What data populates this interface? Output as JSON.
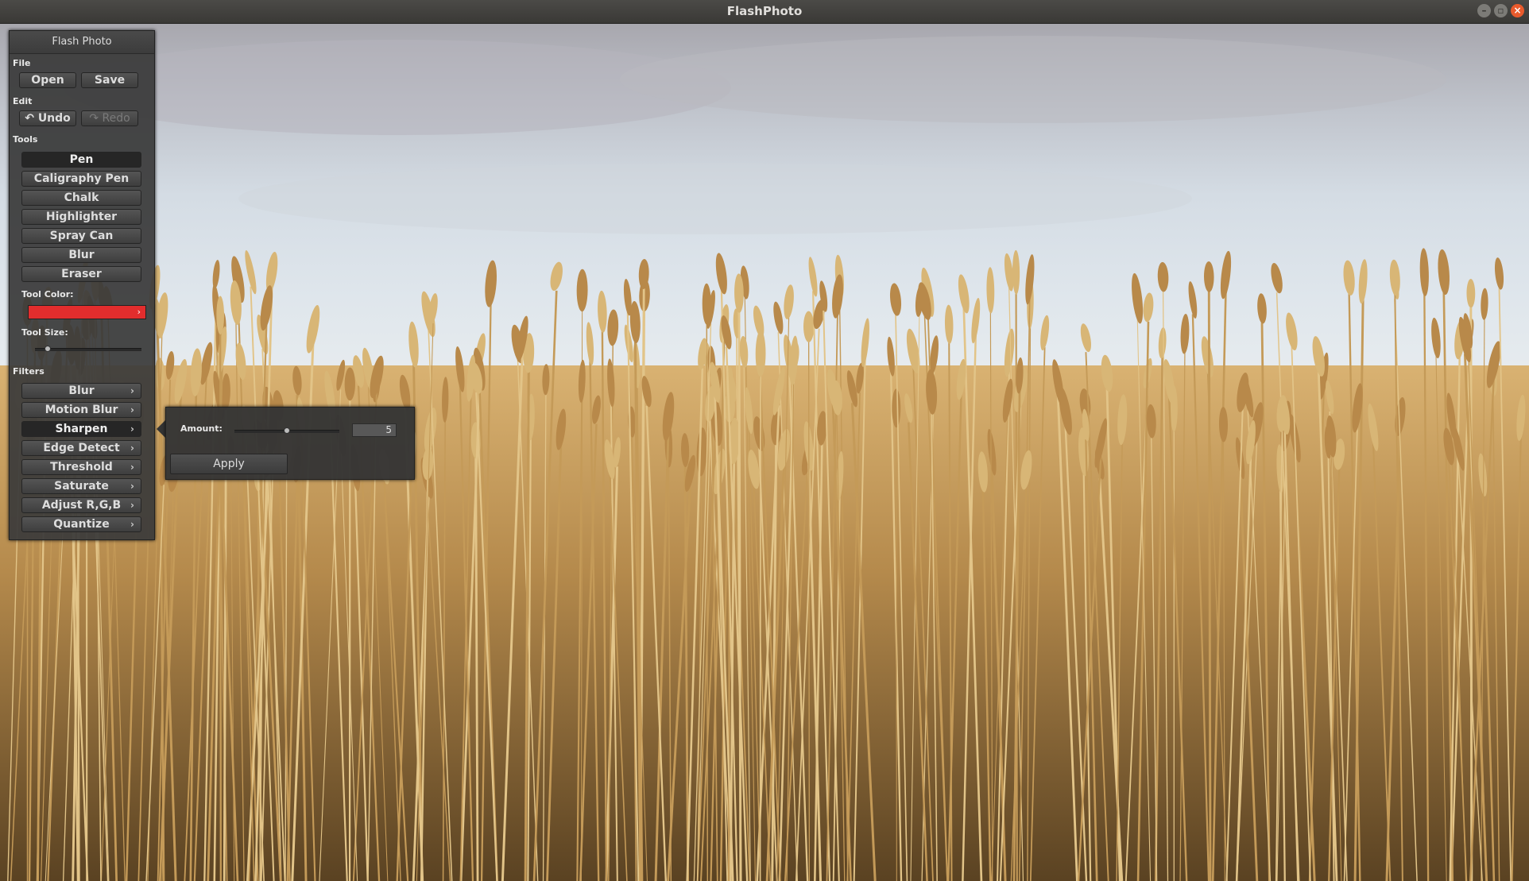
{
  "window": {
    "title": "FlashPhoto",
    "controls": [
      "minimize",
      "maximize",
      "close"
    ]
  },
  "panel": {
    "title": "Flash Photo",
    "file": {
      "label": "File",
      "open": "Open",
      "save": "Save"
    },
    "edit": {
      "label": "Edit",
      "undo": "Undo",
      "redo": "Redo"
    },
    "tools": {
      "label": "Tools",
      "items": [
        "Pen",
        "Caligraphy Pen",
        "Chalk",
        "Highlighter",
        "Spray Can",
        "Blur",
        "Eraser"
      ],
      "selected": "Pen"
    },
    "tool_color": {
      "label": "Tool Color:",
      "value": "#e22d2d"
    },
    "tool_size": {
      "label": "Tool Size:",
      "level": 0.12
    },
    "filters": {
      "label": "Filters",
      "items": [
        "Blur",
        "Motion Blur",
        "Sharpen",
        "Edge Detect",
        "Threshold",
        "Saturate",
        "Adjust R,G,B",
        "Quantize"
      ],
      "active": "Sharpen"
    }
  },
  "popup": {
    "amount_label": "Amount:",
    "amount_value": "5",
    "amount_level": 0.5,
    "apply": "Apply"
  }
}
